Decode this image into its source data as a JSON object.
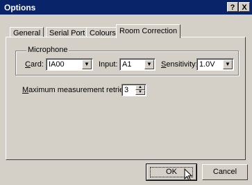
{
  "window": {
    "title": "Options",
    "help_button": "?",
    "close_button": "X"
  },
  "tabs": [
    {
      "label": "General",
      "active": false
    },
    {
      "label": "Serial Port",
      "active": false
    },
    {
      "label": "Colours",
      "active": false
    },
    {
      "label": "Room Correction",
      "active": true
    }
  ],
  "microphone": {
    "group_label": "Microphone",
    "card": {
      "label_mnemonic": "C",
      "label_rest": "ard:",
      "value": "IA00"
    },
    "input": {
      "label": "Input:",
      "value": "A1"
    },
    "sensitivity": {
      "label_mnemonic": "S",
      "label_rest": "ensitivity:",
      "value": "1.0V"
    }
  },
  "retries": {
    "label_mnemonic": "M",
    "label_rest": "aximum measurement retries:",
    "value": "3"
  },
  "buttons": {
    "ok": "OK",
    "cancel": "Cancel"
  }
}
